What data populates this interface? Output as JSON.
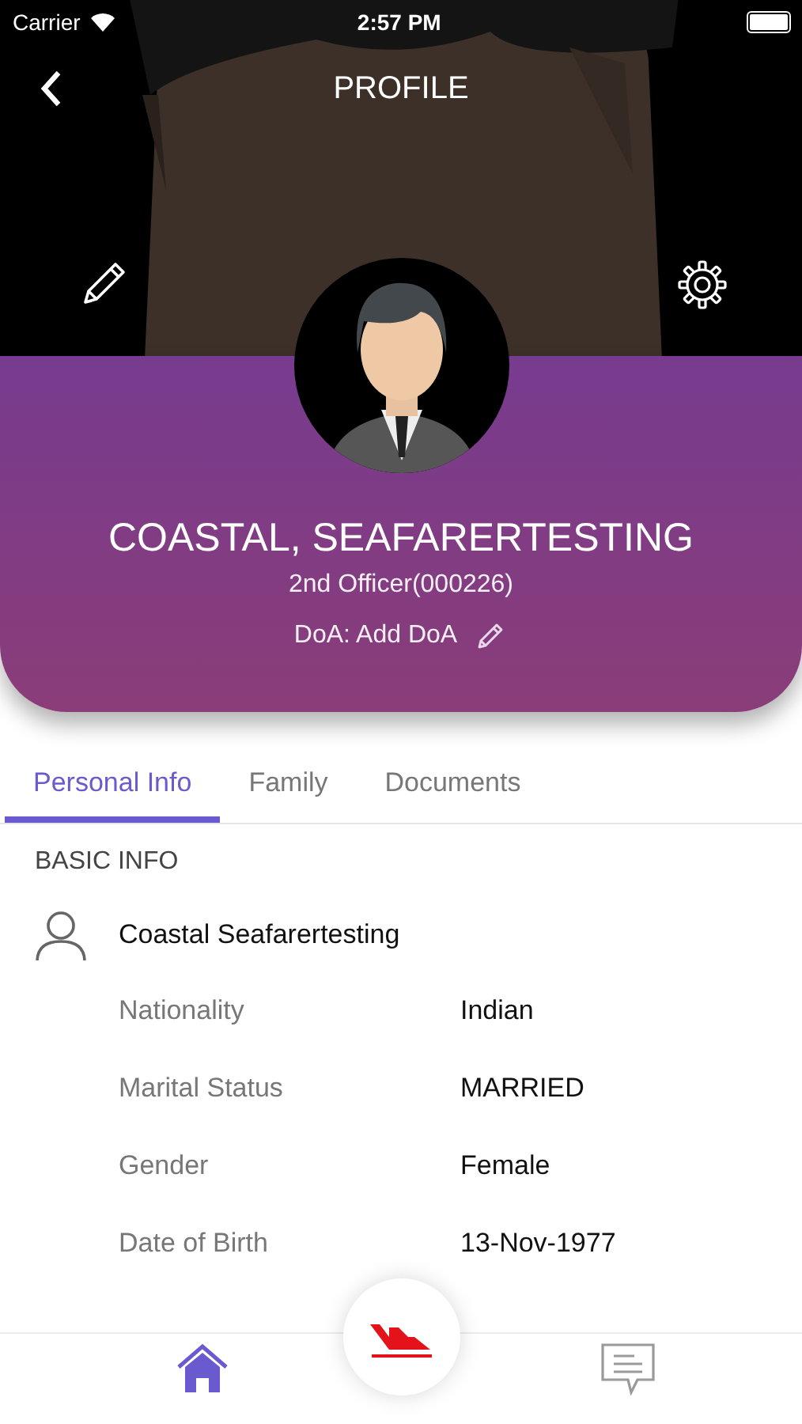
{
  "status_bar": {
    "carrier": "Carrier",
    "time": "2:57 PM"
  },
  "header": {
    "title": "PROFILE"
  },
  "profile": {
    "name": "COASTAL, SEAFARERTESTING",
    "rank": "2nd Officer(000226)",
    "doa": "DoA: Add DoA"
  },
  "tabs": [
    {
      "label": "Personal Info",
      "selected": true
    },
    {
      "label": "Family",
      "selected": false
    },
    {
      "label": "Documents",
      "selected": false
    }
  ],
  "basic_info": {
    "heading": "BASIC INFO",
    "full_name": "Coastal Seafarertesting",
    "fields": [
      {
        "label": "Nationality",
        "value": "Indian"
      },
      {
        "label": "Marital Status",
        "value": "MARRIED"
      },
      {
        "label": "Gender",
        "value": "Female"
      },
      {
        "label": "Date of Birth",
        "value": "13-Nov-1977"
      }
    ]
  },
  "bottom_nav": [
    {
      "kind": "home",
      "selected": true
    },
    {
      "kind": "messages",
      "selected": false
    }
  ]
}
